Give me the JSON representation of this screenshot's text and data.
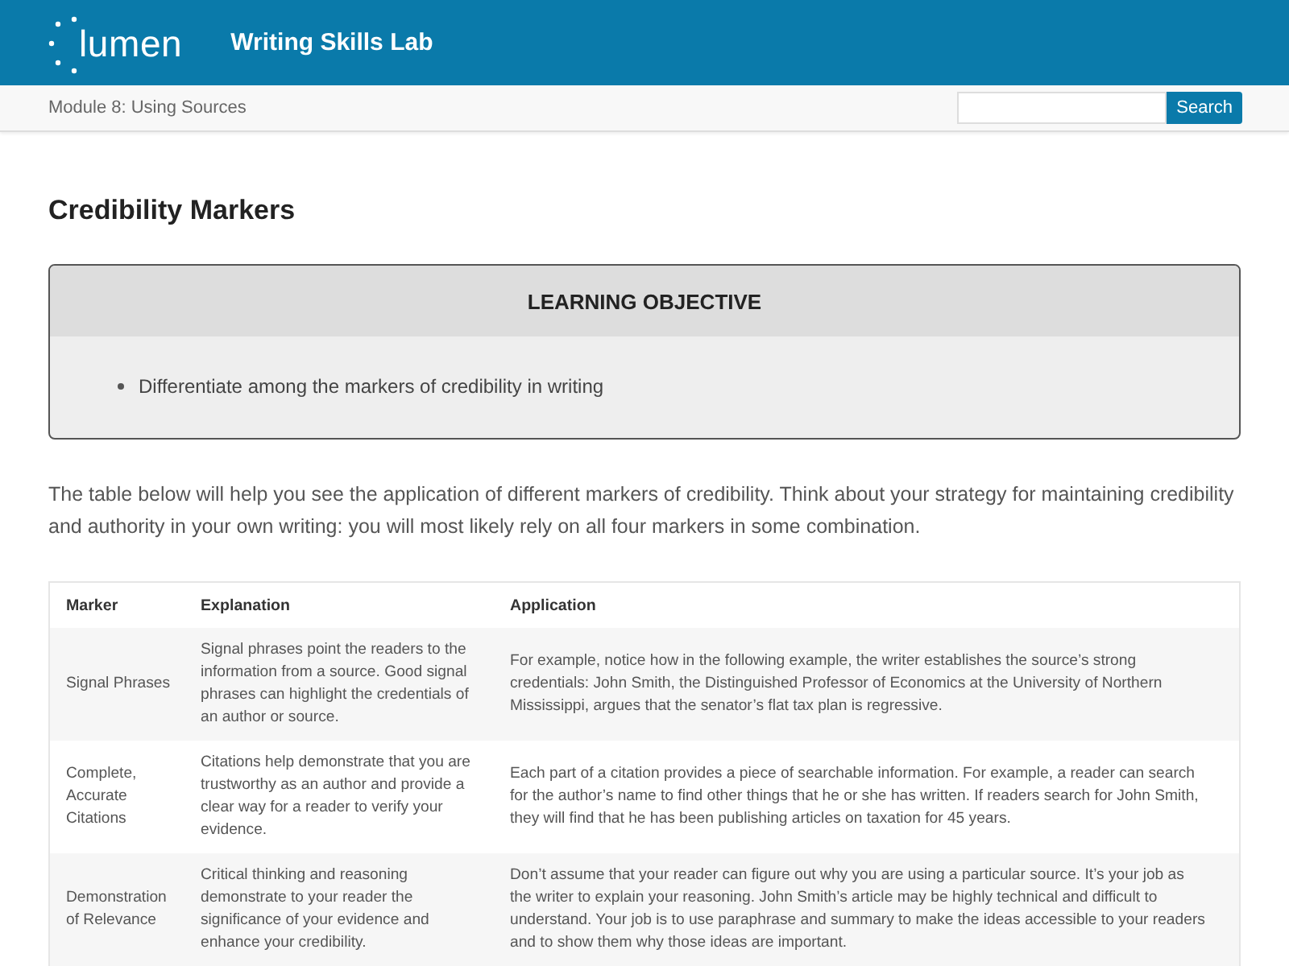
{
  "header": {
    "logo": "lumen",
    "title": "Writing Skills Lab"
  },
  "subbar": {
    "breadcrumb": "Module 8: Using Sources",
    "search_button": "Search"
  },
  "heading": "Credibility Markers",
  "objective": {
    "title": "LEARNING OBJECTIVE",
    "items": [
      "Differentiate among the markers of credibility in writing"
    ]
  },
  "intro": "The table below will help you see the application of different markers of credibility. Think about your strategy for maintaining credibility and authority in your own writing: you will most likely rely on all four markers in some combination.",
  "table": {
    "columns": [
      "Marker",
      "Explanation",
      "Application"
    ],
    "rows": [
      [
        "Signal Phrases",
        "Signal phrases point the readers to the information from a source. Good signal phrases can highlight the credentials of an author or source.",
        "For example, notice how in the following example, the writer establishes the source’s strong credentials: John Smith, the Distinguished Professor of Economics at the University of Northern Mississippi, argues that the senator’s flat tax plan is regressive."
      ],
      [
        "Complete, Accurate Citations",
        "Citations help demonstrate that you are trustworthy as an author and provide a clear way for a reader to verify your evidence.",
        "Each part of a citation provides a piece of searchable information. For example, a reader can search for the author’s name to find other things that he or she has written. If readers search for John Smith, they will find that he has been publishing articles on taxation for 45 years."
      ],
      [
        "Demonstration of Relevance",
        "Critical thinking and reasoning demonstrate to your reader the significance of your evidence and enhance your credibility.",
        "Don’t assume that your reader can figure out why you are using a particular source. It’s your job as the writer to explain your reasoning. John Smith’s article may be highly technical and difficult to understand. Your job is to use paraphrase and summary to make the ideas accessible to your readers and to show them why those ideas are important."
      ]
    ]
  }
}
